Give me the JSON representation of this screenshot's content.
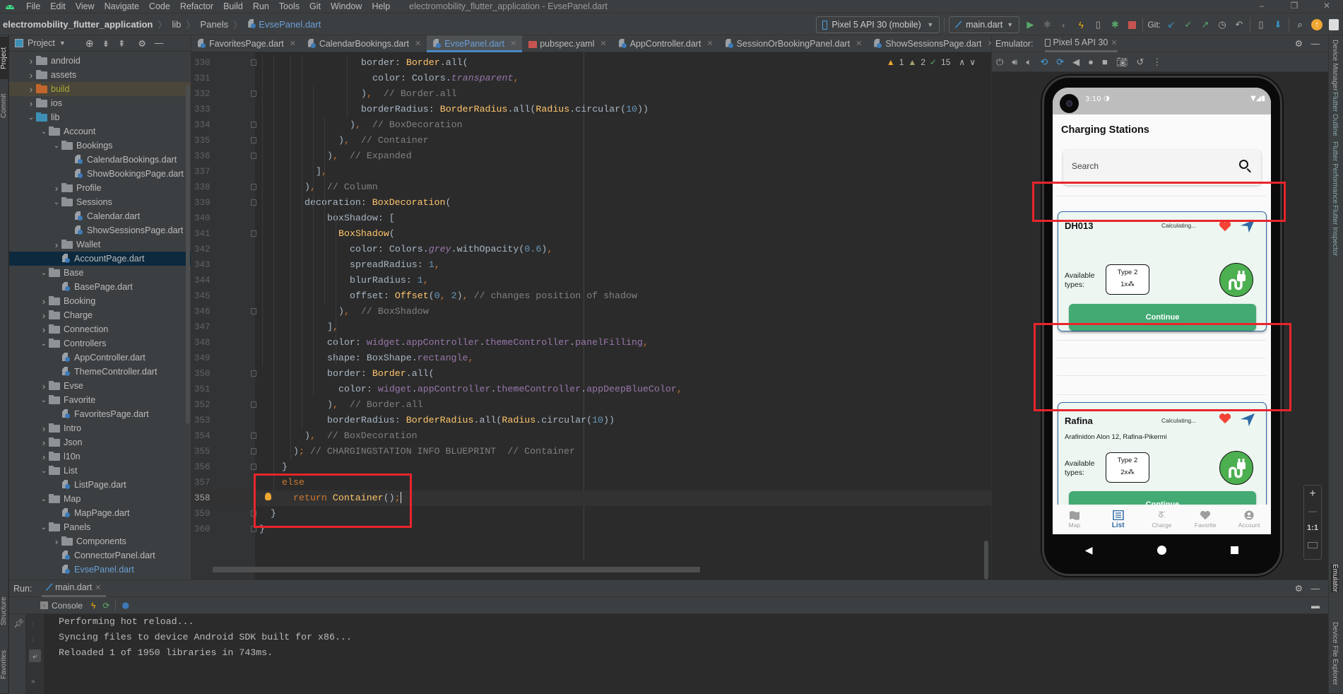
{
  "menu": {
    "items": [
      "File",
      "Edit",
      "View",
      "Navigate",
      "Code",
      "Refactor",
      "Build",
      "Run",
      "Tools",
      "Git",
      "Window",
      "Help"
    ],
    "window_title": "electromobility_flutter_application - EvsePanel.dart"
  },
  "breadcrumb": [
    "electromobility_flutter_application",
    "lib",
    "Panels",
    "EvsePanel.dart"
  ],
  "toolbar": {
    "device": "Pixel 5 API 30 (mobile)",
    "run_config": "main.dart",
    "git_label": "Git:"
  },
  "left_strip": [
    "Project",
    "Commit",
    "Structure",
    "Favorites"
  ],
  "right_strip": [
    "Device Manager",
    "Flutter Outline",
    "Flutter Performance",
    "Flutter Inspector",
    "Emulator",
    "Device File Explorer"
  ],
  "project": {
    "title": "Project",
    "tree": [
      {
        "label": "android",
        "depth": 0,
        "type": "folder",
        "state": "collapsed",
        "variant": "module"
      },
      {
        "label": "assets",
        "depth": 0,
        "type": "folder",
        "state": "collapsed"
      },
      {
        "label": "build",
        "depth": 0,
        "type": "folder",
        "state": "collapsed",
        "variant": "excluded"
      },
      {
        "label": "ios",
        "depth": 0,
        "type": "folder",
        "state": "collapsed",
        "variant": "module"
      },
      {
        "label": "lib",
        "depth": 0,
        "type": "folder",
        "state": "expanded",
        "variant": "source"
      },
      {
        "label": "Account",
        "depth": 1,
        "type": "folder",
        "state": "expanded"
      },
      {
        "label": "Bookings",
        "depth": 2,
        "type": "folder",
        "state": "expanded"
      },
      {
        "label": "CalendarBookings.dart",
        "depth": 3,
        "type": "file"
      },
      {
        "label": "ShowBookingsPage.dart",
        "depth": 3,
        "type": "file"
      },
      {
        "label": "Profile",
        "depth": 2,
        "type": "folder",
        "state": "collapsed"
      },
      {
        "label": "Sessions",
        "depth": 2,
        "type": "folder",
        "state": "expanded"
      },
      {
        "label": "Calendar.dart",
        "depth": 3,
        "type": "file"
      },
      {
        "label": "ShowSessionsPage.dart",
        "depth": 3,
        "type": "file"
      },
      {
        "label": "Wallet",
        "depth": 2,
        "type": "folder",
        "state": "collapsed"
      },
      {
        "label": "AccountPage.dart",
        "depth": 2,
        "type": "file",
        "selected": true
      },
      {
        "label": "Base",
        "depth": 1,
        "type": "folder",
        "state": "expanded"
      },
      {
        "label": "BasePage.dart",
        "depth": 2,
        "type": "file"
      },
      {
        "label": "Booking",
        "depth": 1,
        "type": "folder",
        "state": "collapsed"
      },
      {
        "label": "Charge",
        "depth": 1,
        "type": "folder",
        "state": "collapsed"
      },
      {
        "label": "Connection",
        "depth": 1,
        "type": "folder",
        "state": "collapsed"
      },
      {
        "label": "Controllers",
        "depth": 1,
        "type": "folder",
        "state": "expanded"
      },
      {
        "label": "AppController.dart",
        "depth": 2,
        "type": "file"
      },
      {
        "label": "ThemeController.dart",
        "depth": 2,
        "type": "file"
      },
      {
        "label": "Evse",
        "depth": 1,
        "type": "folder",
        "state": "collapsed"
      },
      {
        "label": "Favorite",
        "depth": 1,
        "type": "folder",
        "state": "expanded"
      },
      {
        "label": "FavoritesPage.dart",
        "depth": 2,
        "type": "file"
      },
      {
        "label": "Intro",
        "depth": 1,
        "type": "folder",
        "state": "collapsed"
      },
      {
        "label": "Json",
        "depth": 1,
        "type": "folder",
        "state": "collapsed"
      },
      {
        "label": "l10n",
        "depth": 1,
        "type": "folder",
        "state": "collapsed"
      },
      {
        "label": "List",
        "depth": 1,
        "type": "folder",
        "state": "expanded"
      },
      {
        "label": "ListPage.dart",
        "depth": 2,
        "type": "file"
      },
      {
        "label": "Map",
        "depth": 1,
        "type": "folder",
        "state": "expanded"
      },
      {
        "label": "MapPage.dart",
        "depth": 2,
        "type": "file"
      },
      {
        "label": "Panels",
        "depth": 1,
        "type": "folder",
        "state": "expanded"
      },
      {
        "label": "Components",
        "depth": 2,
        "type": "folder",
        "state": "collapsed"
      },
      {
        "label": "ConnectorPanel.dart",
        "depth": 2,
        "type": "file"
      },
      {
        "label": "EvsePanel.dart",
        "depth": 2,
        "type": "file",
        "open": true
      }
    ]
  },
  "editor": {
    "tabs": [
      {
        "label": "FavoritesPage.dart",
        "icon": "dart"
      },
      {
        "label": "CalendarBookings.dart",
        "icon": "dart"
      },
      {
        "label": "EvsePanel.dart",
        "icon": "dart",
        "active": true
      },
      {
        "label": "pubspec.yaml",
        "icon": "yaml"
      },
      {
        "label": "AppController.dart",
        "icon": "dart"
      },
      {
        "label": "SessionOrBookingPanel.dart",
        "icon": "dart"
      },
      {
        "label": "ShowSessionsPage.dart",
        "icon": "dart"
      }
    ],
    "inspections": {
      "warnings": "1",
      "weak_warnings": "2",
      "ok": "15"
    },
    "current_line": 358,
    "lines": [
      {
        "n": 330,
        "indent": 18,
        "tokens": [
          [
            "",
            "border: "
          ],
          [
            "cl",
            "Border"
          ],
          [
            "",
            ".all("
          ]
        ]
      },
      {
        "n": 331,
        "indent": 20,
        "tokens": [
          [
            "",
            "color: Colors."
          ],
          [
            "pi",
            "transparent"
          ],
          [
            "k",
            ","
          ]
        ]
      },
      {
        "n": 332,
        "indent": 18,
        "tokens": [
          [
            "",
            ")"
          ],
          [
            "k",
            ","
          ],
          [
            "c",
            "  // Border.all"
          ]
        ]
      },
      {
        "n": 333,
        "indent": 18,
        "tokens": [
          [
            "",
            "borderRadius: "
          ],
          [
            "cl",
            "BorderRadius"
          ],
          [
            "",
            ".all("
          ],
          [
            "cl",
            "Radius"
          ],
          [
            "",
            ".circular("
          ],
          [
            "n",
            "10"
          ],
          [
            "",
            "))"
          ]
        ]
      },
      {
        "n": 334,
        "indent": 16,
        "tokens": [
          [
            "",
            ")"
          ],
          [
            "k",
            ","
          ],
          [
            "c",
            "  // BoxDecoration"
          ]
        ]
      },
      {
        "n": 335,
        "indent": 14,
        "tokens": [
          [
            "",
            ")"
          ],
          [
            "k",
            ","
          ],
          [
            "c",
            "  // Container"
          ]
        ]
      },
      {
        "n": 336,
        "indent": 12,
        "tokens": [
          [
            "",
            ")"
          ],
          [
            "k",
            ","
          ],
          [
            "c",
            "  // Expanded"
          ]
        ]
      },
      {
        "n": 337,
        "indent": 10,
        "tokens": [
          [
            "",
            "]"
          ],
          [
            "k",
            ","
          ]
        ]
      },
      {
        "n": 338,
        "indent": 8,
        "tokens": [
          [
            "",
            ")"
          ],
          [
            "k",
            ","
          ],
          [
            "c",
            "  // Column"
          ]
        ]
      },
      {
        "n": 339,
        "indent": 8,
        "tokens": [
          [
            "",
            "decoration: "
          ],
          [
            "cl",
            "BoxDecoration"
          ],
          [
            "",
            "("
          ]
        ]
      },
      {
        "n": 340,
        "indent": 12,
        "tokens": [
          [
            "",
            "boxShadow: ["
          ]
        ]
      },
      {
        "n": 341,
        "indent": 14,
        "tokens": [
          [
            "cl",
            "BoxShadow"
          ],
          [
            "",
            "("
          ]
        ]
      },
      {
        "n": 342,
        "indent": 16,
        "tokens": [
          [
            "",
            "color: Colors."
          ],
          [
            "pi",
            "grey"
          ],
          [
            "",
            ".withOpacity("
          ],
          [
            "n",
            "0.6"
          ],
          [
            "",
            ")"
          ],
          [
            "k",
            ","
          ]
        ]
      },
      {
        "n": 343,
        "indent": 16,
        "tokens": [
          [
            "",
            "spreadRadius: "
          ],
          [
            "n",
            "1"
          ],
          [
            "k",
            ","
          ]
        ]
      },
      {
        "n": 344,
        "indent": 16,
        "tokens": [
          [
            "",
            "blurRadius: "
          ],
          [
            "n",
            "1"
          ],
          [
            "k",
            ","
          ]
        ]
      },
      {
        "n": 345,
        "indent": 16,
        "tokens": [
          [
            "",
            "offset: "
          ],
          [
            "cl",
            "Offset"
          ],
          [
            "",
            "("
          ],
          [
            "n",
            "0"
          ],
          [
            "k",
            ", "
          ],
          [
            "n",
            "2"
          ],
          [
            "",
            ")"
          ],
          [
            "k",
            ","
          ],
          [
            "c",
            " // changes position of shadow"
          ]
        ]
      },
      {
        "n": 346,
        "indent": 14,
        "tokens": [
          [
            "",
            ")"
          ],
          [
            "k",
            ","
          ],
          [
            "c",
            "  // BoxShadow"
          ]
        ]
      },
      {
        "n": 347,
        "indent": 12,
        "tokens": [
          [
            "",
            "]"
          ],
          [
            "k",
            ","
          ]
        ]
      },
      {
        "n": 348,
        "indent": 12,
        "tokens": [
          [
            "",
            "color: "
          ],
          [
            "p",
            "widget"
          ],
          [
            "",
            "."
          ],
          [
            "p",
            "appController"
          ],
          [
            "",
            "."
          ],
          [
            "p",
            "themeController"
          ],
          [
            "",
            "."
          ],
          [
            "p",
            "panelFilling"
          ],
          [
            "k",
            ","
          ]
        ]
      },
      {
        "n": 349,
        "indent": 12,
        "tokens": [
          [
            "",
            "shape: BoxShape."
          ],
          [
            "p",
            "rectangle"
          ],
          [
            "k",
            ","
          ]
        ]
      },
      {
        "n": 350,
        "indent": 12,
        "tokens": [
          [
            "",
            "border: "
          ],
          [
            "cl",
            "Border"
          ],
          [
            "",
            ".all("
          ]
        ]
      },
      {
        "n": 351,
        "indent": 14,
        "tokens": [
          [
            "",
            "color: "
          ],
          [
            "p",
            "widget"
          ],
          [
            "",
            "."
          ],
          [
            "p",
            "appController"
          ],
          [
            "",
            "."
          ],
          [
            "p",
            "themeController"
          ],
          [
            "",
            "."
          ],
          [
            "p",
            "appDeepBlueColor"
          ],
          [
            "k",
            ","
          ]
        ]
      },
      {
        "n": 352,
        "indent": 12,
        "tokens": [
          [
            "",
            ")"
          ],
          [
            "k",
            ","
          ],
          [
            "c",
            "  // Border.all"
          ]
        ]
      },
      {
        "n": 353,
        "indent": 12,
        "tokens": [
          [
            "",
            "borderRadius: "
          ],
          [
            "cl",
            "BorderRadius"
          ],
          [
            "",
            ".all("
          ],
          [
            "cl",
            "Radius"
          ],
          [
            "",
            ".circular("
          ],
          [
            "n",
            "10"
          ],
          [
            "",
            "))"
          ]
        ]
      },
      {
        "n": 354,
        "indent": 8,
        "tokens": [
          [
            "",
            ")"
          ],
          [
            "k",
            ","
          ],
          [
            "c",
            "  // BoxDecoration"
          ]
        ]
      },
      {
        "n": 355,
        "indent": 6,
        "tokens": [
          [
            "",
            ")"
          ],
          [
            "k",
            ";"
          ],
          [
            "c",
            " // CHARGINGSTATION INFO BLUEPRINT  // Container"
          ]
        ]
      },
      {
        "n": 356,
        "indent": 4,
        "tokens": [
          [
            "",
            "}"
          ]
        ]
      },
      {
        "n": 357,
        "indent": 4,
        "tokens": [
          [
            "k",
            "else"
          ]
        ]
      },
      {
        "n": 358,
        "indent": 6,
        "tokens": [
          [
            "k",
            "return "
          ],
          [
            "cl",
            "Container"
          ],
          [
            "",
            "()"
          ],
          [
            "k",
            ";"
          ]
        ]
      },
      {
        "n": 359,
        "indent": 2,
        "tokens": [
          [
            "",
            "}"
          ]
        ]
      },
      {
        "n": 360,
        "indent": 0,
        "tokens": [
          [
            "",
            "}"
          ]
        ]
      }
    ]
  },
  "emulator": {
    "label": "Emulator:",
    "device_tab": "Pixel 5 API 30",
    "zoom_controls": [
      "+",
      "—",
      "1:1"
    ],
    "phone": {
      "status_time": "3:10",
      "app_title": "Charging Stations",
      "search_placeholder": "Search",
      "cards": [
        {
          "name": "DH013",
          "distance": "Calculating...",
          "address": "",
          "available_label": "Available types:",
          "type_name": "Type 2",
          "type_count": "1x",
          "button": "Continue",
          "favorite": true
        },
        {
          "name": "Rafina",
          "distance": "Calculating...",
          "address": "Arafinidon Alon 12, Rafina-Pikermi",
          "available_label": "Available types:",
          "type_name": "Type 2",
          "type_count": "2x",
          "button": "Continue",
          "favorite": true
        }
      ],
      "bottom_nav": [
        {
          "label": "Map",
          "icon": "map-icon"
        },
        {
          "label": "List",
          "icon": "list-icon",
          "active": true
        },
        {
          "label": "Charge",
          "icon": "charge-icon"
        },
        {
          "label": "Favorite",
          "icon": "heart-icon"
        },
        {
          "label": "Account",
          "icon": "account-icon"
        }
      ]
    }
  },
  "run": {
    "label": "Run:",
    "tab": "main.dart",
    "console_label": "Console",
    "output": [
      "Performing hot reload...",
      "Syncing files to device Android SDK built for x86...",
      "Reloaded 1 of 1950 libraries in 743ms."
    ]
  },
  "colors": {
    "accent_blue": "#4a88c7",
    "annotation_red": "#e8252b",
    "continue_green": "#43aa74",
    "plug_green": "#4caf50",
    "app_blue": "#2f6aa5"
  }
}
